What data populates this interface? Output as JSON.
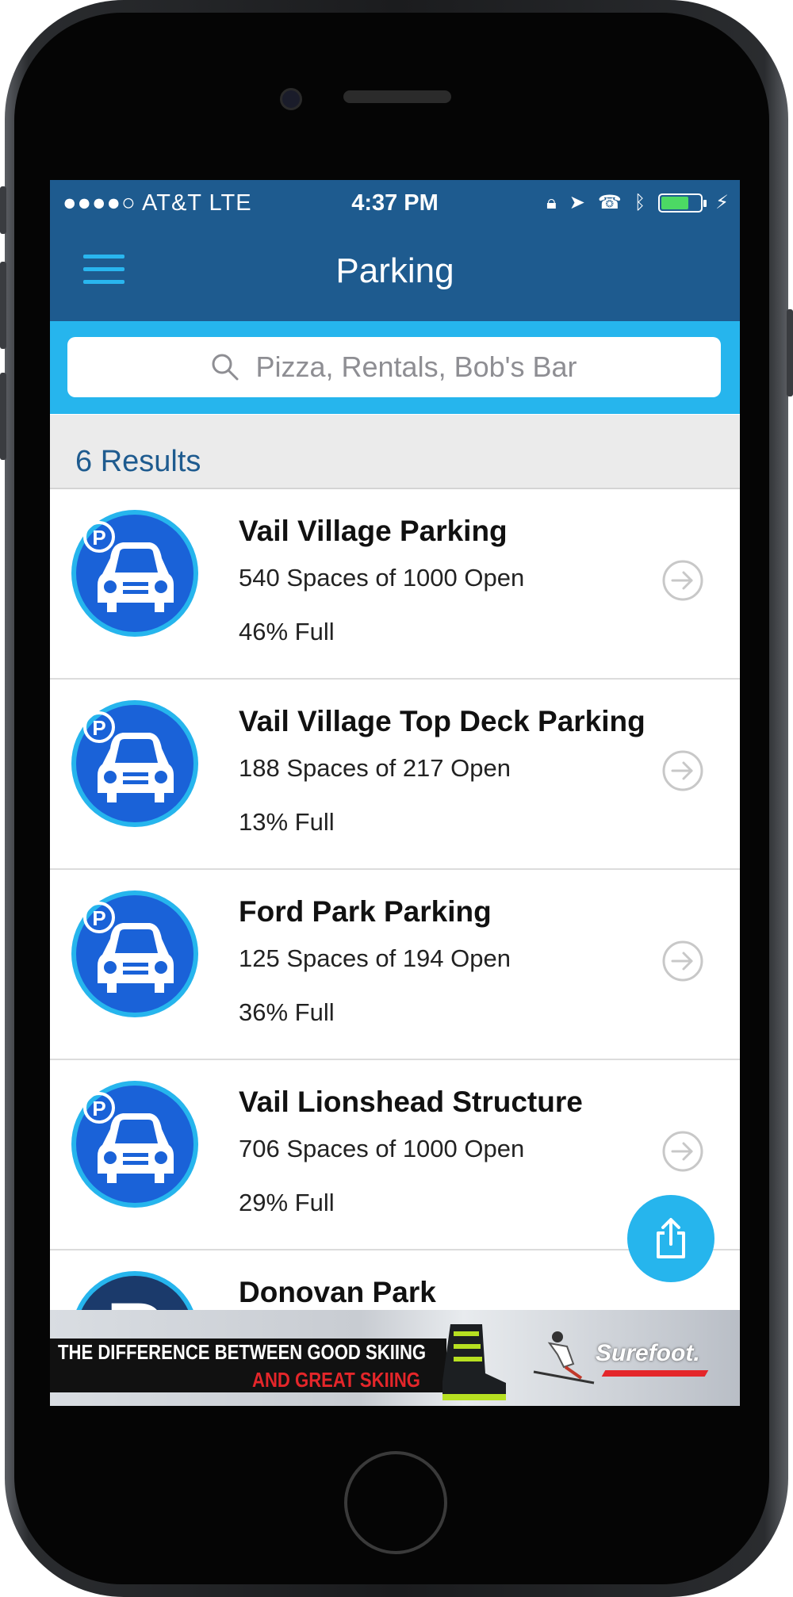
{
  "status_bar": {
    "carrier": "●●●●○ AT&T  LTE",
    "time": "4:37 PM",
    "battery_level": 0.7
  },
  "nav": {
    "title": "Parking",
    "menu_icon": "hamburger-menu-icon"
  },
  "search": {
    "placeholder": "Pizza, Rentals, Bob's Bar"
  },
  "results": {
    "count_label": "6 Results"
  },
  "parking_lots": [
    {
      "name": "Vail Village Parking",
      "spaces": "540 Spaces of 1000 Open",
      "full": "46% Full"
    },
    {
      "name": "Vail Village Top Deck Parking",
      "spaces": "188 Spaces of 217 Open",
      "full": "13% Full"
    },
    {
      "name": "Ford Park Parking",
      "spaces": "125 Spaces of 194 Open",
      "full": "36% Full"
    },
    {
      "name": "Vail Lionshead Structure",
      "spaces": "706 Spaces of 1000 Open",
      "full": "29% Full"
    },
    {
      "name": "Donovan Park",
      "spaces": "",
      "full": ""
    }
  ],
  "ad": {
    "line1": "THE DIFFERENCE BETWEEN GOOD SKIING",
    "line2": "AND GREAT SKIING",
    "brand": "Surefoot."
  },
  "colors": {
    "nav_blue": "#1e5b8f",
    "accent_cyan": "#26b5ed",
    "icon_blue": "#1a62d8"
  }
}
